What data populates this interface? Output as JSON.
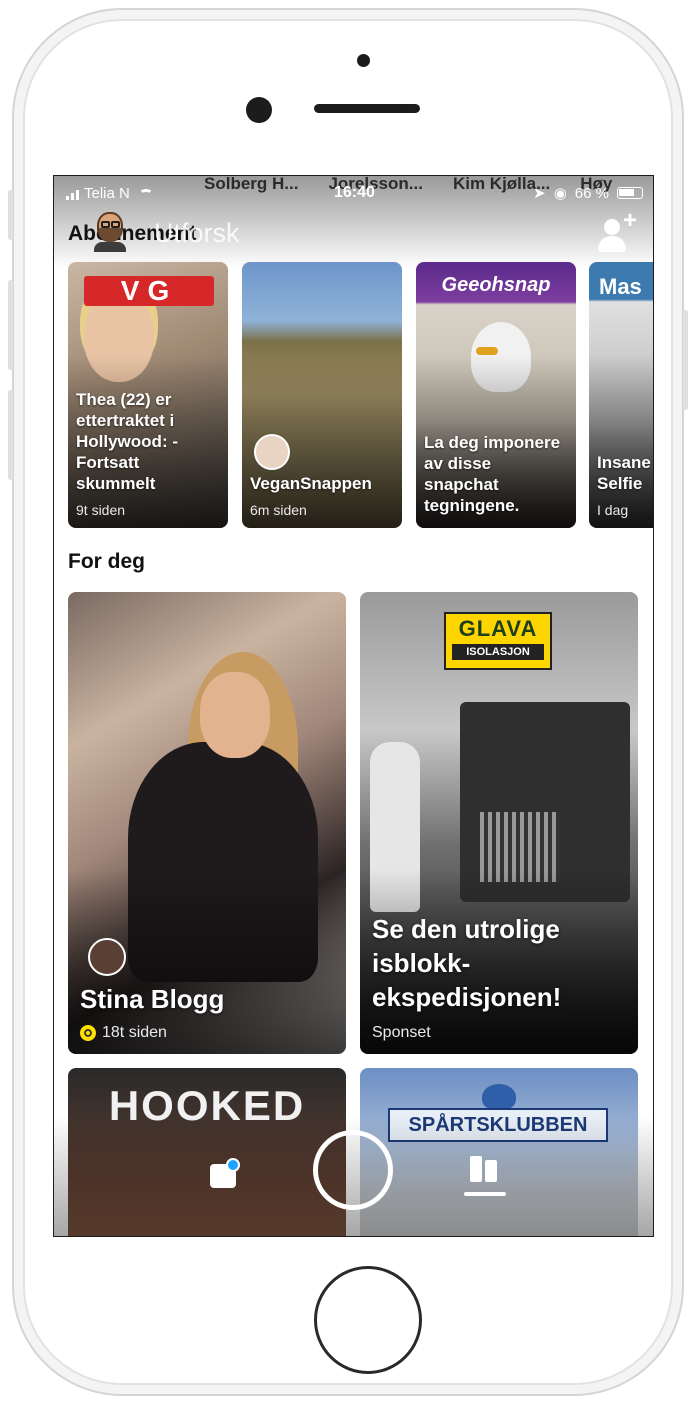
{
  "status_bar": {
    "carrier": "Telia N",
    "time": "16:40",
    "battery": "66 %"
  },
  "friend_strip": [
    "Solberg H...",
    "Jorelsson...",
    "Kim Kjølla...",
    "Høy"
  ],
  "header": {
    "section_title": "Abonnement",
    "search_placeholder": "Utforsk"
  },
  "subscriptions": [
    {
      "title": "Thea (22) er ettertraktet i Hollywood: - Fortsatt skummelt",
      "meta": "9t siden",
      "logo": "VG"
    },
    {
      "title": "VeganSnappen",
      "meta": "6m siden"
    },
    {
      "title": "La deg imponere av disse snapchat tegningene.",
      "meta": "",
      "logo": "Geeohsnap"
    },
    {
      "title": "Insane Selfie",
      "meta": "I dag",
      "logo": "Mas"
    }
  ],
  "for_deg": {
    "title": "For deg",
    "cards": [
      {
        "title": "Stina Blogg",
        "meta": "18t siden"
      },
      {
        "title": "Se den utrolige isblokk-ekspedisjonen!",
        "meta": "Sponset",
        "logo_top": "GLAVA",
        "logo_bottom": "ISOLASJON"
      }
    ],
    "lower_cards": [
      {
        "title": "HOOKED"
      },
      {
        "title": "SPÅRTSKLUBBEN"
      }
    ]
  },
  "nav": {
    "chat_icon": "chat-icon",
    "capture_icon": "capture-icon",
    "discover_icon": "discover-icon",
    "notification_color": "#1ea4ff"
  }
}
